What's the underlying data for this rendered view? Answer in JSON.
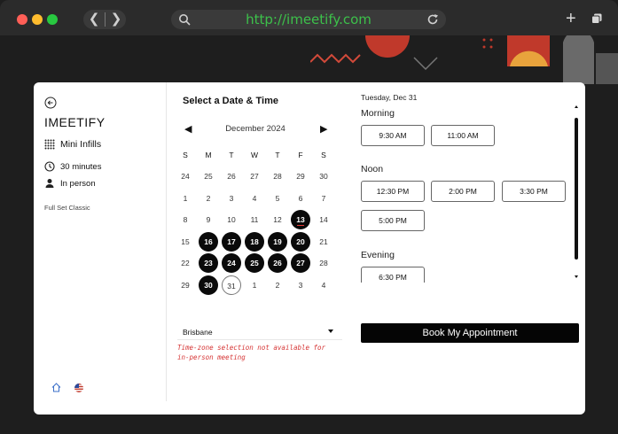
{
  "browser": {
    "url": "http://imeetify.com",
    "colors": {
      "close": "#ff5f57",
      "minimize": "#febc2e",
      "maximize": "#28c840",
      "url": "#3cc04a"
    }
  },
  "sidebar": {
    "brand": "IMEETIFY",
    "service": "Mini Infills",
    "duration": "30 minutes",
    "location": "In person",
    "category": "Full Set Classic"
  },
  "calendar": {
    "heading": "Select a Date & Time",
    "month_label": "December 2024",
    "weekdays": [
      "S",
      "M",
      "T",
      "W",
      "T",
      "F",
      "S"
    ],
    "weeks": [
      [
        {
          "d": "24"
        },
        {
          "d": "25"
        },
        {
          "d": "26"
        },
        {
          "d": "27"
        },
        {
          "d": "28"
        },
        {
          "d": "29"
        },
        {
          "d": "30"
        }
      ],
      [
        {
          "d": "1"
        },
        {
          "d": "2"
        },
        {
          "d": "3"
        },
        {
          "d": "4"
        },
        {
          "d": "5"
        },
        {
          "d": "6"
        },
        {
          "d": "7"
        }
      ],
      [
        {
          "d": "8"
        },
        {
          "d": "9"
        },
        {
          "d": "10"
        },
        {
          "d": "11"
        },
        {
          "d": "12"
        },
        {
          "d": "13",
          "state": "selected"
        },
        {
          "d": "14"
        }
      ],
      [
        {
          "d": "15"
        },
        {
          "d": "16",
          "state": "available"
        },
        {
          "d": "17",
          "state": "available"
        },
        {
          "d": "18",
          "state": "available"
        },
        {
          "d": "19",
          "state": "available"
        },
        {
          "d": "20",
          "state": "available"
        },
        {
          "d": "21"
        }
      ],
      [
        {
          "d": "22"
        },
        {
          "d": "23",
          "state": "available"
        },
        {
          "d": "24",
          "state": "available"
        },
        {
          "d": "25",
          "state": "available"
        },
        {
          "d": "26",
          "state": "available"
        },
        {
          "d": "27",
          "state": "available"
        },
        {
          "d": "28"
        }
      ],
      [
        {
          "d": "29"
        },
        {
          "d": "30",
          "state": "available"
        },
        {
          "d": "31",
          "state": "today"
        },
        {
          "d": "1"
        },
        {
          "d": "2"
        },
        {
          "d": "3"
        },
        {
          "d": "4"
        }
      ]
    ],
    "timezone": "Brisbane",
    "timezone_note": "Time-zone selection not available for in-person meeting"
  },
  "times": {
    "date_label": "Tuesday, Dec 31",
    "sections": [
      {
        "label": "Morning",
        "slots": [
          "9:30 AM",
          "11:00 AM"
        ]
      },
      {
        "label": "Noon",
        "slots": [
          "12:30 PM",
          "2:00 PM",
          "3:30 PM",
          "5:00 PM"
        ]
      },
      {
        "label": "Evening",
        "slots": [
          "6:30 PM"
        ]
      }
    ]
  },
  "book_button": "Book My Appointment"
}
